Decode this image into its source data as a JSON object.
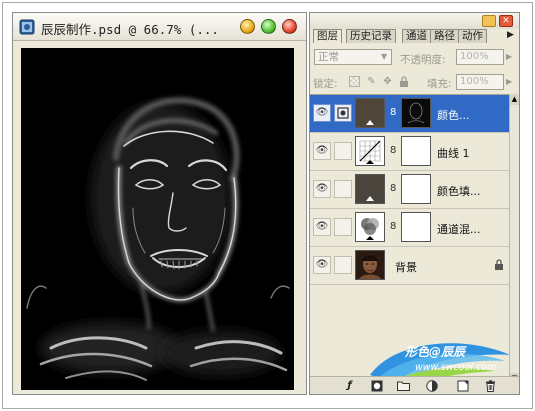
{
  "document": {
    "title": "辰辰制作.psd @ 66.7% (..."
  },
  "panel": {
    "tabs": [
      {
        "label": "图层"
      },
      {
        "label": "历史记录"
      },
      {
        "label": "通道"
      },
      {
        "label": "路径"
      },
      {
        "label": "动作"
      }
    ],
    "blend_mode": "正常",
    "opacity_label": "不透明度:",
    "opacity_value": "100%",
    "lock_label": "锁定:",
    "fill_label": "填充:",
    "fill_value": "100%",
    "layers": [
      {
        "name": "颜色...",
        "selected": true
      },
      {
        "name": "曲线 1"
      },
      {
        "name": "颜色填..."
      },
      {
        "name": "通道混..."
      },
      {
        "name": "背景",
        "locked": true
      }
    ]
  },
  "watermark": {
    "title": "形色@辰辰",
    "url": "www.swcool.com"
  },
  "colors": {
    "selection": "#316ac5",
    "panel_bg": "#ece9d8",
    "fill_layer_color": "#4f4538"
  }
}
